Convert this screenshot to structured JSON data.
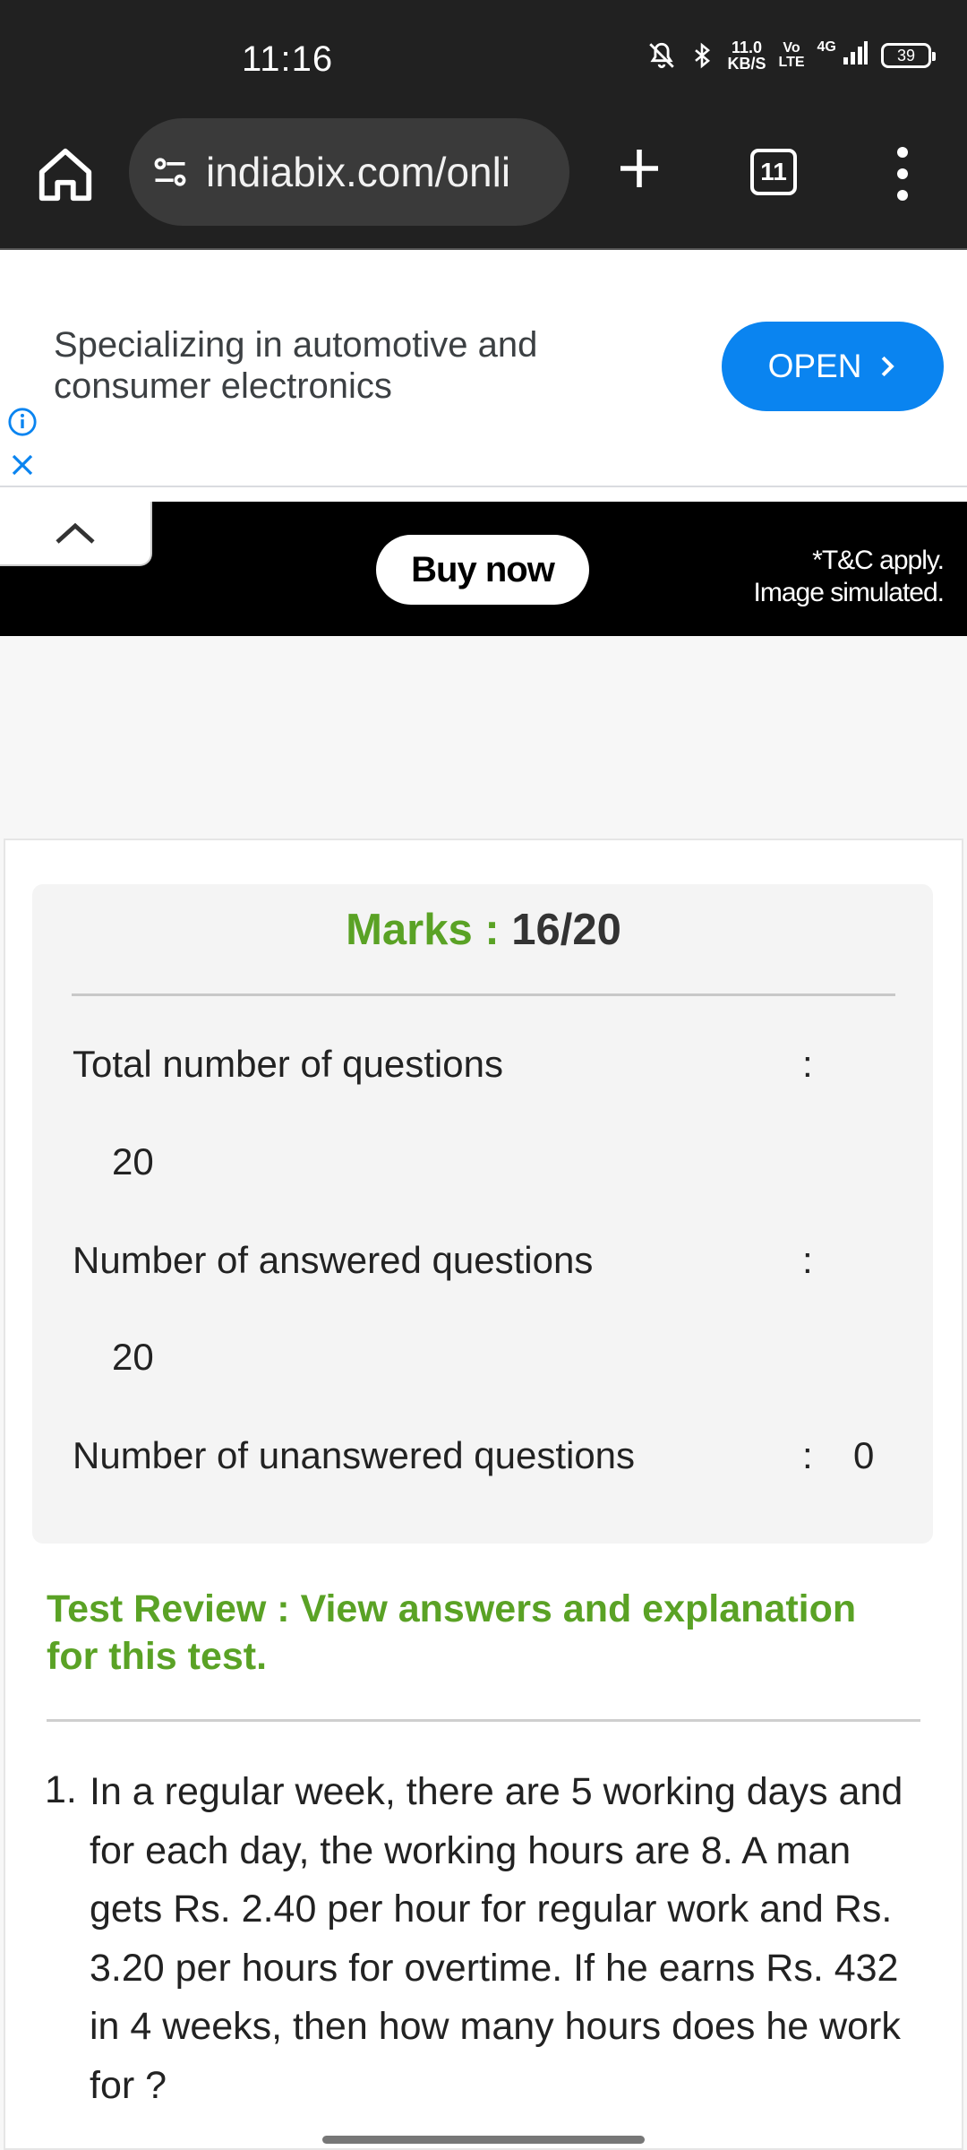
{
  "status_bar": {
    "time": "11:16",
    "net_speed_value": "11.0",
    "net_speed_unit": "KB/S",
    "volte_top": "Vo",
    "volte_bottom": "LTE",
    "network": "4G",
    "battery": "39"
  },
  "browser": {
    "url": "indiabix.com/onli",
    "tab_count": "11"
  },
  "ad": {
    "text": "Specializing in automotive and consumer electronics",
    "open_label": "OPEN",
    "buy_now_label": "Buy now",
    "tnc_line1": "*T&C apply.",
    "tnc_line2": "Image simulated."
  },
  "result": {
    "marks_label": "Marks :",
    "marks_value": "16/20",
    "stats": [
      {
        "label": "Total number of questions",
        "colon": ":",
        "value": "20"
      },
      {
        "label": "Number of answered questions",
        "colon": ":",
        "value": "20"
      },
      {
        "label": "Number of unanswered questions",
        "colon": ":",
        "value": "0"
      }
    ]
  },
  "review": {
    "link_text": "Test Review : View answers and explanation for this test."
  },
  "question": {
    "number": "1.",
    "text": "In a regular week, there are 5 working days and for each day, the working hours are 8. A man gets Rs. 2.40 per hour for regular work and Rs. 3.20 per hours for overtime. If he earns Rs. 432 in 4 weeks, then how many hours does he work for ?"
  },
  "colors": {
    "accent_green": "#5aa225",
    "ad_button_blue": "#0a84f0",
    "toolbar_dark": "#212121"
  }
}
